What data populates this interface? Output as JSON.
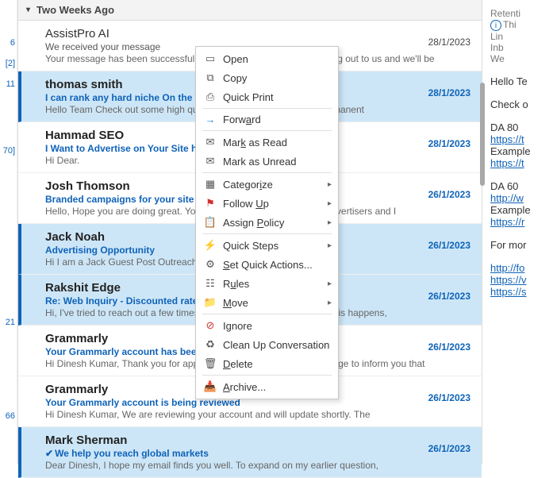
{
  "left_counts": {
    "c1": "6",
    "c2": "[2]",
    "c3": "11",
    "c4": "70]",
    "c5": "21",
    "c6": "66"
  },
  "group_header": "Two Weeks Ago",
  "messages": [
    {
      "sender": "AssistPro AI",
      "subject": "We received your message",
      "preview": "Your message has been successfully received. Thank you for reaching out to us and we'll be",
      "date": "28/1/2023"
    },
    {
      "sender": "thomas smith",
      "subject": "I can rank any hard niche On the Top of Google",
      "preview": "Hello Team  Check out some high quality backlinks. Our links are permanent",
      "date": "28/1/2023"
    },
    {
      "sender": "Hammad SEO",
      "subject": "I Want to Advertise on Your Site https://example.com",
      "preview": "Hi Dear.",
      "date": "28/1/2023"
    },
    {
      "sender": "Josh Thomson",
      "subject": "Branded campaigns for your site - synonymous",
      "preview": "Hello,  Hope you are doing great.  You might be getting emails from advertisers and I",
      "date": "26/1/2023"
    },
    {
      "sender": "Jack Noah",
      "subject": "Advertising Opportunity",
      "preview": "Hi  I am a Jack  Guest Post Outreach Consultant.  Time: 09:00 - 18:00",
      "date": "26/1/2023"
    },
    {
      "sender": "Rakshit Edge",
      "subject": "Re: Web Inquiry - Discounted rates",
      "preview": "Hi,  I've tried to reach out a few times but haven't heard back. When this happens,",
      "date": "26/1/2023"
    },
    {
      "sender": "Grammarly",
      "subject": "Your Grammarly account has been reviewed",
      "preview": "Hi Dinesh Kumar,  Thank you for applying. We are sending this message to inform you that",
      "date": "26/1/2023"
    },
    {
      "sender": "Grammarly",
      "subject": "Your Grammarly account is being reviewed",
      "preview": "Hi Dinesh Kumar,   We are reviewing your account and will update shortly. The",
      "date": "26/1/2023"
    },
    {
      "sender": "Mark Sherman",
      "subject": "We help you reach global markets",
      "preview": "Dear Dinesh,  I hope my email finds you well. To expand on my earlier question,",
      "date": "26/1/2023",
      "tick": "✔"
    }
  ],
  "ctx": {
    "open": "Open",
    "copy": "Copy",
    "quick_print": "Quick Print",
    "forward": "Forward",
    "mark_read": "Mark as Read",
    "mark_unread": "Mark as Unread",
    "categorize": "Categorize",
    "follow_up": "Follow Up",
    "assign_policy": "Assign Policy",
    "quick_steps": "Quick Steps",
    "set_quick_actions": "Set Quick Actions...",
    "rules": "Rules",
    "move": "Move",
    "ignore": "Ignore",
    "clean_up": "Clean Up Conversation",
    "delete": "Delete",
    "archive": "Archive..."
  },
  "reading": {
    "retention": "Retenti",
    "info1": "Thi",
    "info2": "Lin",
    "info3": "Inb",
    "info4": "We",
    "greet": "Hello Te",
    "line1": "Check o",
    "da80": "DA 80",
    "link1": "https://t",
    "ex1": "Example",
    "link2": "https://t",
    "da60": "DA 60",
    "link3": "http://w",
    "ex2": "Example",
    "link4": "https://r",
    "more": "For mor",
    "link5": "http://fo",
    "link6": "https://v",
    "link7": "https://s"
  }
}
